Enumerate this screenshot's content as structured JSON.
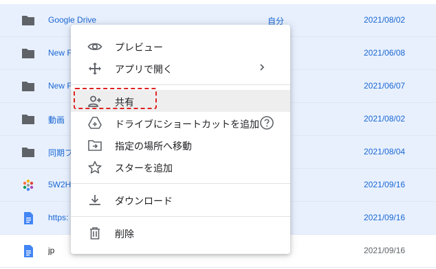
{
  "files": [
    {
      "name": "Google Drive",
      "owner": "自分",
      "date": "2021/08/02"
    },
    {
      "name": "New F",
      "owner": "",
      "date": "2021/06/08"
    },
    {
      "name": "New F",
      "owner": "",
      "date": "2021/06/07"
    },
    {
      "name": "動画",
      "owner": "",
      "date": "2021/08/02"
    },
    {
      "name": "同期フ",
      "owner": "",
      "date": "2021/08/04"
    },
    {
      "name": "5W2H",
      "owner": "",
      "date": "2021/09/16"
    },
    {
      "name": "https:",
      "owner": "",
      "date": "2021/09/16"
    },
    {
      "name": "jp",
      "owner": "",
      "date": "2021/09/16"
    }
  ],
  "menu": {
    "preview": "プレビュー",
    "open_with": "アプリで開く",
    "share": "共有",
    "add_shortcut": "ドライブにショートカットを追加",
    "move": "指定の場所へ移動",
    "star": "スターを追加",
    "download": "ダウンロード",
    "delete": "削除"
  },
  "colors": {
    "selected_row": "#e8f0fe",
    "link_text": "#1967d2",
    "highlight_box": "#e02020"
  }
}
